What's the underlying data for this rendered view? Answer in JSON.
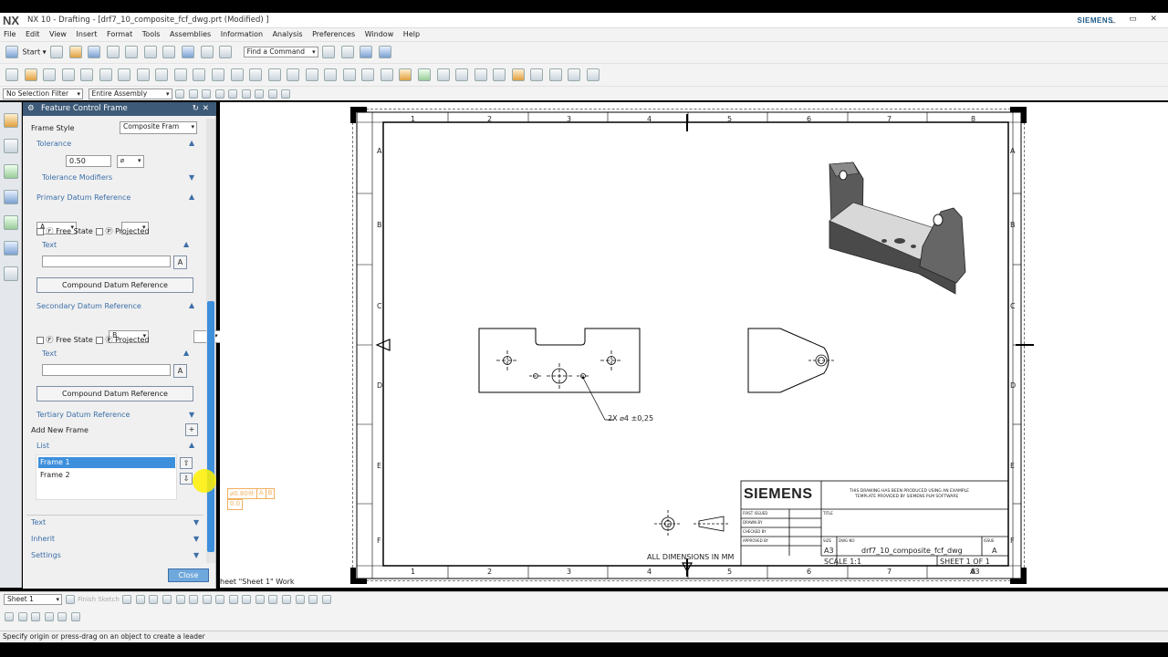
{
  "app": {
    "logo": "NX",
    "title": "NX 10 - Drafting - [drf7_10_composite_fcf_dwg.prt (Modified) ]",
    "brand": "SIEMENS",
    "window_controls": "_ ▭ ✕"
  },
  "menu": [
    "File",
    "Edit",
    "View",
    "Insert",
    "Format",
    "Tools",
    "Assemblies",
    "Information",
    "Analysis",
    "Preferences",
    "Window",
    "Help"
  ],
  "toolbar": {
    "start_label": "Start ▾",
    "find_command_placeholder": "Find a Command",
    "selection_filter": "No Selection Filter",
    "assembly_scope": "Entire Assembly"
  },
  "dialog": {
    "title": "Feature Control Frame",
    "frame_style_label": "Frame Style",
    "frame_style_value": "Composite Fram",
    "tolerance_section": "Tolerance",
    "tolerance_symbol": "⌀",
    "tolerance_value": "0.50",
    "material_modifier": "Ⓜ",
    "tolerance_modifiers": "Tolerance Modifiers",
    "primary_section": "Primary Datum Reference",
    "primary_datum": "A",
    "secondary_section": "Secondary Datum Reference",
    "secondary_datum": "B",
    "free_state_label": "Free State",
    "projected_label": "Projected",
    "free_state_glyph": "Ⓕ",
    "projected_glyph": "Ⓟ",
    "text_label": "Text",
    "compound_button": "Compound Datum Reference",
    "tertiary_section": "Tertiary Datum Reference",
    "add_new_frame": "Add New Frame",
    "list_section": "List",
    "frames": [
      "Frame 1",
      "Frame 2"
    ],
    "collapsed_sections": [
      "Text",
      "Inherit",
      "Settings"
    ],
    "close_button": "Close"
  },
  "preview_fcf": {
    "row1": [
      "⌀0.80Ⓜ",
      "A",
      "B"
    ],
    "row2": "0.0"
  },
  "drawing": {
    "col_labels": [
      "1",
      "2",
      "3",
      "4",
      "5",
      "6",
      "7",
      "8"
    ],
    "row_labels": [
      "A",
      "B",
      "C",
      "D",
      "E",
      "F"
    ],
    "annotation": "2X  ⌀4  ±0,25",
    "all_dims_note": "ALL DIMENSIONS IN MM",
    "sheet_work_label": "heet \"Sheet 1\" Work",
    "title_block": {
      "company": "SIEMENS",
      "note_line1": "THIS DRAWING HAS BEEN PRODUCED USING AN EXAMPLE",
      "note_line2": "TEMPLATE PROVIDED BY SIEMENS PLM SOFTWARE",
      "first_issued": "FIRST ISSUED",
      "drawn_by": "DRAWN BY",
      "checked_by": "CHECKED BY",
      "approved_by": "APPROVED BY",
      "title_label": "TITLE",
      "size_label": "SIZE",
      "dwg_no_label": "DWG NO",
      "issue_label": "ISSUE",
      "size": "A3",
      "dwg_no": "drf7_10_composite_fcf_dwg",
      "issue": "A",
      "scale": "SCALE 1:1",
      "sheet": "SHEET 1 OF 1",
      "paper": "A3"
    }
  },
  "bottom": {
    "sheet_select": "Sheet 1",
    "finish_sketch": "Finish Sketch"
  },
  "status": "Specify origin or press-drag on an object to create a leader",
  "colors": {
    "accent": "#3d5a78",
    "section": "#3c6fa8",
    "selection": "#3d8fdc",
    "preview": "#f0b060"
  }
}
